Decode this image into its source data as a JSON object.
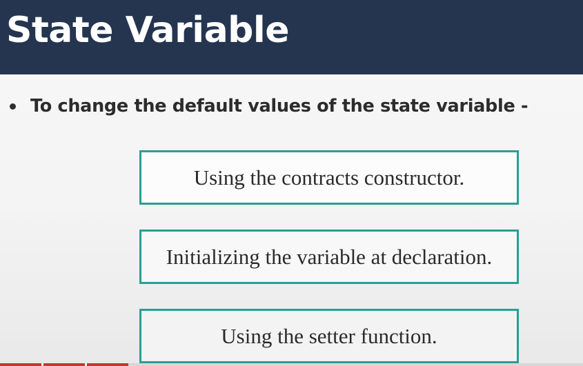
{
  "slide": {
    "title": "State Variable",
    "bullet": "To change the default values of the state variable -",
    "options": [
      "Using the contracts constructor.",
      "Initializing the variable at declaration.",
      "Using the setter function."
    ]
  },
  "colors": {
    "title_bar": "#253550",
    "title_text": "#ffffff",
    "box_border": "#2a9d95",
    "body_text": "#2c2c2c"
  }
}
